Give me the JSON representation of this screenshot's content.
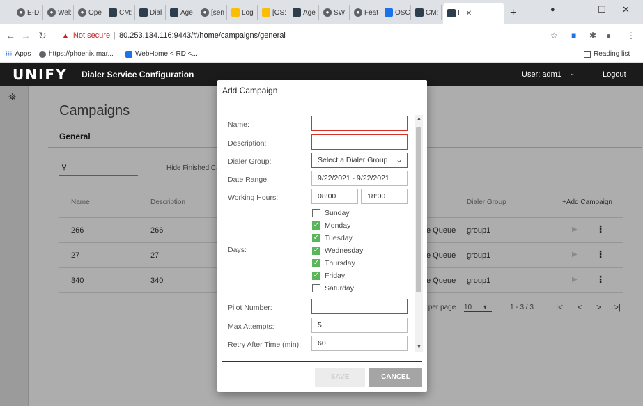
{
  "browser": {
    "tabs": [
      {
        "label": "E-D:"
      },
      {
        "label": "Wel:"
      },
      {
        "label": "Ope"
      },
      {
        "label": "CM:"
      },
      {
        "label": "Dial"
      },
      {
        "label": "Age"
      },
      {
        "label": "[sen"
      },
      {
        "label": "Log"
      },
      {
        "label": "[OS:"
      },
      {
        "label": "Age"
      },
      {
        "label": "SW"
      },
      {
        "label": "Feat"
      },
      {
        "label": "OSC"
      },
      {
        "label": "CM:"
      },
      {
        "label": "I"
      }
    ],
    "not_secure": "Not secure",
    "url": "80.253.134.116:9443/#/home/campaigns/general",
    "bookmarks": [
      "Apps",
      "https://phoenix.mar...",
      "WebHome < RD <..."
    ],
    "reading_list": "Reading list"
  },
  "header": {
    "logo": "UNIFY",
    "title": "Dialer Service Configuration",
    "user": "User: adm1",
    "logout": "Logout"
  },
  "page": {
    "title": "Campaigns",
    "subtab": "General",
    "hide_finished": "Hide Finished Ca",
    "columns": [
      "Name",
      "Description",
      "Dialer Group",
      "+Add Campaign"
    ],
    "rows": [
      {
        "name": "266",
        "description": "266",
        "type": "e Queue",
        "group": "group1"
      },
      {
        "name": "27",
        "description": "27",
        "type": "e Queue",
        "group": "group1"
      },
      {
        "name": "340",
        "description": "340",
        "type": "e Queue",
        "group": "group1"
      }
    ],
    "pager": {
      "per_page_label": "s per page",
      "per_page": "10",
      "range": "1 - 3 / 3"
    }
  },
  "dialog": {
    "title": "Add Campaign",
    "fields": {
      "name_label": "Name:",
      "description_label": "Description:",
      "dialer_group_label": "Dialer Group:",
      "dialer_group_value": "Select a Dialer Group",
      "date_range_label": "Date Range:",
      "date_range_value": "9/22/2021 - 9/22/2021",
      "working_hours_label": "Working Hours:",
      "working_start": "08:00",
      "working_end": "18:00",
      "days_label": "Days:",
      "pilot_label": "Pilot Number:",
      "max_attempts_label": "Max Attempts:",
      "max_attempts_value": "5",
      "retry_label": "Retry After Time (min):",
      "retry_value": "60"
    },
    "days": [
      {
        "label": "Sunday",
        "checked": false
      },
      {
        "label": "Monday",
        "checked": true
      },
      {
        "label": "Tuesday",
        "checked": true
      },
      {
        "label": "Wednesday",
        "checked": true
      },
      {
        "label": "Thursday",
        "checked": true
      },
      {
        "label": "Friday",
        "checked": true
      },
      {
        "label": "Saturday",
        "checked": false
      }
    ],
    "save_label": "SAVE",
    "cancel_label": "CANCEL"
  }
}
